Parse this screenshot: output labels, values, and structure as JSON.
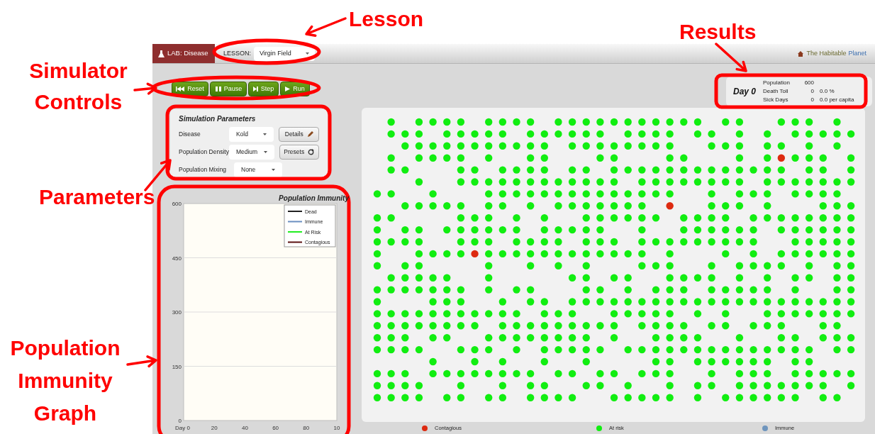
{
  "annotations": [
    {
      "text": "Lesson"
    },
    {
      "text": "Results"
    },
    {
      "text": "Simulator Controls"
    },
    {
      "text": "Parameters"
    },
    {
      "text": "Population Immunity Graph"
    }
  ],
  "top_bar": {
    "lab": "LAB: Disease",
    "lesson_label": "LESSON:",
    "lesson_value": "Virgin Field",
    "brand_name": "The Habitable",
    "brand_suffix": "Planet"
  },
  "controls": [
    {
      "label": "Reset",
      "kind": "reset"
    },
    {
      "label": "Pause",
      "kind": "pause"
    },
    {
      "label": "Step",
      "kind": "step"
    },
    {
      "label": "Run",
      "kind": "run"
    }
  ],
  "parameters": {
    "title": "Simulation Parameters",
    "rows": [
      {
        "label": "Disease",
        "value": "Kold",
        "button": "Details",
        "kind": "edit"
      },
      {
        "label": "Population Density",
        "value": "Medium",
        "button": "Presets",
        "kind": "refresh"
      },
      {
        "label": "Population Mixing",
        "value": "None"
      }
    ]
  },
  "results": {
    "day": "Day 0",
    "rows": [
      {
        "label": "Population",
        "value": "600"
      },
      {
        "label": "Death Toll",
        "value": "0",
        "extra": "0.0 %"
      },
      {
        "label": "Sick Days",
        "value": "0",
        "extra": "0.0 per capita"
      }
    ]
  },
  "graph": {
    "chart_data": {
      "type": "line",
      "title": "Population Immunity",
      "categories": [
        "Day 0",
        "20",
        "40",
        "60",
        "80",
        "10"
      ],
      "ylim": [
        0,
        600
      ],
      "yticks": [
        0,
        150,
        300,
        450,
        600
      ],
      "grid": true,
      "series": [
        {
          "name": "Dead",
          "color": "#222222",
          "values": [
            null,
            null,
            null,
            null,
            null,
            null
          ]
        },
        {
          "name": "Immune",
          "color": "#6a8fc0",
          "values": [
            null,
            null,
            null,
            null,
            null,
            null
          ]
        },
        {
          "name": "At Risk",
          "color": "#22ee22",
          "values": [
            null,
            null,
            null,
            null,
            null,
            null
          ]
        },
        {
          "name": "Contagious",
          "color": "#5a1010",
          "values": [
            null,
            null,
            null,
            null,
            null,
            null
          ]
        }
      ]
    }
  },
  "legend": [
    {
      "label": "Contagious",
      "color": "#dd2a10"
    },
    {
      "label": "At risk",
      "color": "#11ee11"
    },
    {
      "label": "Immune",
      "color": "#6f95bd"
    }
  ]
}
